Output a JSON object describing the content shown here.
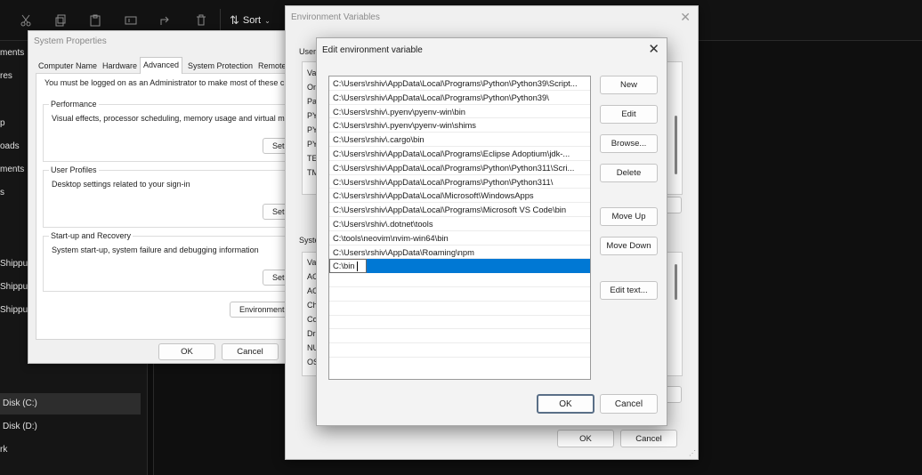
{
  "explorer": {
    "sort_label": "Sort",
    "icons": [
      "cut-icon",
      "copy-icon",
      "paste-icon",
      "rename-icon",
      "share-icon",
      "delete-icon",
      "sort-icon"
    ],
    "nav_items": [
      "ments",
      "res",
      "p",
      "oads",
      "ments",
      "s",
      "Shippu",
      "Shippu",
      "Shippu",
      "Disk (C:)",
      "Disk (D:)",
      "rk"
    ]
  },
  "sysprops": {
    "title": "System Properties",
    "tabs": [
      "Computer Name",
      "Hardware",
      "Advanced",
      "System Protection",
      "Remote"
    ],
    "active_tab": "Advanced",
    "admin_note": "You must be logged on as an Administrator to make most of these cha",
    "performance": {
      "label": "Performance",
      "desc": "Visual effects, processor scheduling, memory usage and virtual mem",
      "button": "Set"
    },
    "profiles": {
      "label": "User Profiles",
      "desc": "Desktop settings related to your sign-in",
      "button": "Set"
    },
    "startup": {
      "label": "Start-up and Recovery",
      "desc": "System start-up, system failure and debugging information",
      "button": "Set"
    },
    "env_button": "Environment Va",
    "ok": "OK",
    "cancel": "Cancel"
  },
  "envvars": {
    "title": "Environment Variables",
    "user_label_frag": "User",
    "user_rows_frag": [
      "Va",
      "On",
      "Pa",
      "PY",
      "PY",
      "PY",
      "TE",
      "TM"
    ],
    "system_label_frag": "Syste",
    "system_rows_frag": [
      "Va",
      "AC",
      "AC",
      "Ch",
      "Co",
      "Dr",
      "NU",
      "OS"
    ],
    "ok": "OK",
    "cancel": "Cancel"
  },
  "editdlg": {
    "title": "Edit environment variable",
    "paths": [
      "C:\\Users\\rshiv\\AppData\\Local\\Programs\\Python\\Python39\\Script...",
      "C:\\Users\\rshiv\\AppData\\Local\\Programs\\Python\\Python39\\",
      "C:\\Users\\rshiv\\.pyenv\\pyenv-win\\bin",
      "C:\\Users\\rshiv\\.pyenv\\pyenv-win\\shims",
      "C:\\Users\\rshiv\\.cargo\\bin",
      "C:\\Users\\rshiv\\AppData\\Local\\Programs\\Eclipse Adoptium\\jdk-...",
      "C:\\Users\\rshiv\\AppData\\Local\\Programs\\Python\\Python311\\Scri...",
      "C:\\Users\\rshiv\\AppData\\Local\\Programs\\Python\\Python311\\",
      "C:\\Users\\rshiv\\AppData\\Local\\Microsoft\\WindowsApps",
      "C:\\Users\\rshiv\\AppData\\Local\\Programs\\Microsoft VS Code\\bin",
      "C:\\Users\\rshiv\\.dotnet\\tools",
      "C:\\tools\\neovim\\nvim-win64\\bin",
      "C:\\Users\\rshiv\\AppData\\Roaming\\npm"
    ],
    "editing_value": "C:\\bin",
    "buttons": {
      "new": "New",
      "edit": "Edit",
      "browse": "Browse...",
      "delete": "Delete",
      "move_up": "Move Up",
      "move_down": "Move Down",
      "edit_text": "Edit text...",
      "ok": "OK",
      "cancel": "Cancel"
    },
    "accent_color": "#0078d4"
  }
}
